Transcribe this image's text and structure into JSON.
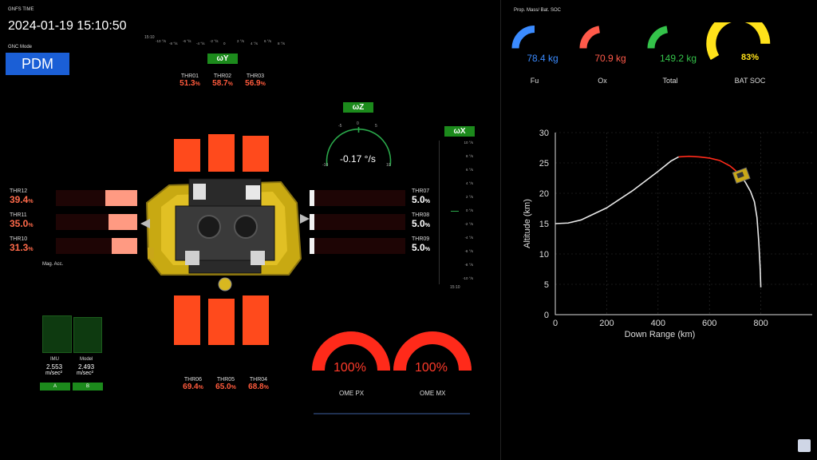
{
  "header": {
    "time_label": "GNFS TIME",
    "time_value": "2024-01-19 15:10:50",
    "gnc_label": "GNC Mode",
    "gnc_value": "PDM"
  },
  "prop_panel": {
    "title": "Prop. Mass/ Bat. SOC",
    "gauges": [
      {
        "name": "Fu",
        "value": "78.4 kg",
        "color": "#3b8bff",
        "fraction": 0.5
      },
      {
        "name": "Ox",
        "value": "70.9 kg",
        "color": "#ff5a4a",
        "fraction": 0.45
      },
      {
        "name": "Total",
        "value": "149.2 kg",
        "color": "#34c24a",
        "fraction": 0.45
      },
      {
        "name": "BAT SOC",
        "value": "83%",
        "color": "#ffe21a",
        "fraction": 0.83
      }
    ]
  },
  "wy": {
    "label": "ωY",
    "tick_start": "15:10",
    "ticks": [
      "-10 °/s",
      "-8 °/s",
      "-6 °/s",
      "-4 °/s",
      "-2 °/s",
      "0",
      "2 °/s",
      "4 °/s",
      "6 °/s",
      "8 °/s"
    ]
  },
  "wz": {
    "label": "ωZ",
    "value": "-0.17 °/s",
    "ticks": [
      "-5",
      "0",
      "5",
      "-10",
      "10"
    ]
  },
  "wx": {
    "label": "ωX",
    "ticks": [
      "10 °/s",
      "8 °/s",
      "6 °/s",
      "4 °/s",
      "2 °/s",
      "0 °/s",
      "-2 °/s",
      "-4 °/s",
      "-6 °/s",
      "-8 °/s",
      "-10 °/s"
    ],
    "time": "15:10"
  },
  "thrusters": {
    "top": [
      {
        "name": "THR01",
        "value": "51.3",
        "unit": "%",
        "level": 0.513
      },
      {
        "name": "THR02",
        "value": "58.7",
        "unit": "%",
        "level": 0.587
      },
      {
        "name": "THR03",
        "value": "56.9",
        "unit": "%",
        "level": 0.569
      }
    ],
    "bottom": [
      {
        "name": "THR06",
        "value": "69.4",
        "unit": "%",
        "level": 0.694
      },
      {
        "name": "THR05",
        "value": "65.0",
        "unit": "%",
        "level": 0.65
      },
      {
        "name": "THR04",
        "value": "68.8",
        "unit": "%",
        "level": 0.688
      }
    ],
    "left": [
      {
        "name": "THR12",
        "value": "39.4",
        "unit": "%",
        "level": 0.394
      },
      {
        "name": "THR11",
        "value": "35.0",
        "unit": "%",
        "level": 0.35
      },
      {
        "name": "THR10",
        "value": "31.3",
        "unit": "%",
        "level": 0.313
      }
    ],
    "right": [
      {
        "name": "THR07",
        "value": "5.0",
        "unit": "%",
        "level": 0.05
      },
      {
        "name": "THR08",
        "value": "5.0",
        "unit": "%",
        "level": 0.05
      },
      {
        "name": "THR09",
        "value": "5.0",
        "unit": "%",
        "level": 0.05
      }
    ]
  },
  "mag_acc": {
    "title": "Mag. Acc.",
    "imu_label": "IMU",
    "imu_value": "2.553",
    "imu_unit": "m/sec²",
    "model_label": "Model",
    "model_value": "2.493",
    "model_unit": "m/sec²",
    "btn_a": "A",
    "btn_b": "B"
  },
  "ome": [
    {
      "name": "OME PX",
      "value": "100%",
      "fraction": 1.0
    },
    {
      "name": "OME MX",
      "value": "100%",
      "fraction": 1.0
    }
  ],
  "chart_data": {
    "type": "line",
    "xlabel": "Down Range (km)",
    "ylabel": "Altitude (km)",
    "xlim": [
      0,
      1000
    ],
    "ylim": [
      0,
      30
    ],
    "xticks": [
      0,
      200,
      400,
      600,
      800
    ],
    "yticks": [
      0,
      5,
      10,
      15,
      20,
      25,
      30
    ],
    "grid": true,
    "series": [
      {
        "color": "#e8e8e8",
        "x": [
          0,
          50,
          100,
          200,
          300,
          400,
          450,
          480
        ],
        "y": [
          15.0,
          15.1,
          15.6,
          17.6,
          20.4,
          23.6,
          25.3,
          26.0
        ]
      },
      {
        "color": "#ff2a1a",
        "x": [
          480,
          520,
          560,
          600,
          640,
          680,
          700,
          720
        ],
        "y": [
          26.0,
          26.1,
          26.0,
          25.8,
          25.4,
          24.5,
          23.8,
          23.0
        ]
      },
      {
        "color": "#e8e8e8",
        "x": [
          720,
          740,
          760,
          775,
          785,
          792,
          797,
          800
        ],
        "y": [
          23.0,
          21.8,
          20.3,
          18.6,
          16.0,
          12.0,
          8.0,
          4.5
        ]
      }
    ]
  }
}
